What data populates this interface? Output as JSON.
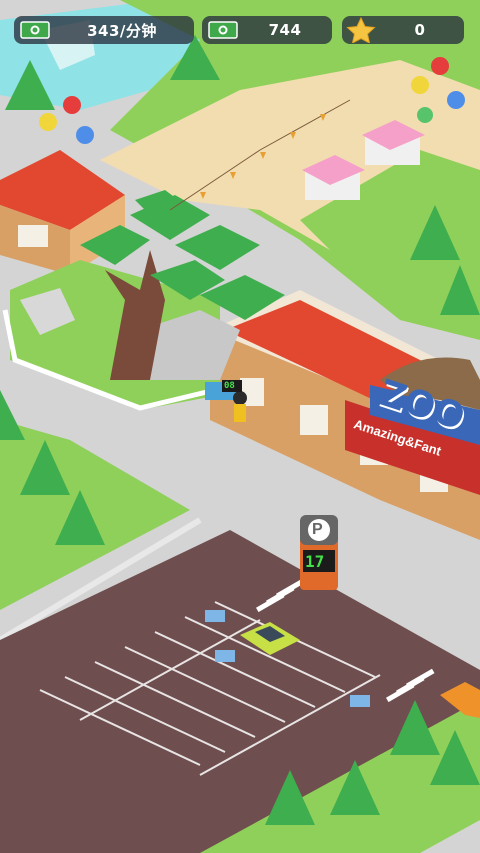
{
  "hud": {
    "income_rate": "343/分钟",
    "money": "744",
    "stars": "0",
    "income_icon": "cash-icon",
    "money_icon": "cash-icon",
    "star_icon": "star-icon"
  },
  "scene": {
    "zoo_sign_title": "ZOO",
    "zoo_sign_subtitle": "Amazing&Fant",
    "gate_counter": "08",
    "parking_sign_letter": "P",
    "parking_counter": "17"
  },
  "colors": {
    "grass": "#8fd05a",
    "path": "#f2ddb0",
    "road": "#d3d3d3",
    "parking_lot": "#6e4e4e",
    "water": "#8fe2e6",
    "building_wall": "#d9a066",
    "roof_red": "#e2472f",
    "sign_red": "#c8302b",
    "sign_blue": "#3a67b8"
  }
}
